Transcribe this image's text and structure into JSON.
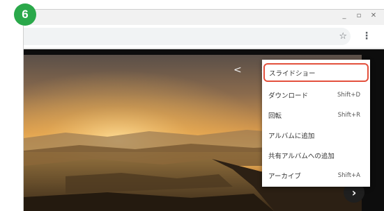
{
  "step_number": "6",
  "window": {
    "controls": [
      "_",
      "▫",
      "✕"
    ]
  },
  "toolbar": {
    "star_icon": "☆",
    "menu_icon": "⋮"
  },
  "viewer": {
    "share_icon": "<",
    "more_icon": "⋮",
    "next_icon": "›"
  },
  "menu": {
    "items": [
      {
        "label": "スライドショー",
        "shortcut": "",
        "highlighted": true
      },
      {
        "label": "ダウンロード",
        "shortcut": "Shift+D"
      },
      {
        "label": "回転",
        "shortcut": "Shift+R"
      },
      {
        "label": "アルバムに追加",
        "shortcut": ""
      },
      {
        "label": "共有アルバムへの追加",
        "shortcut": ""
      },
      {
        "label": "アーカイブ",
        "shortcut": "Shift+A"
      }
    ]
  },
  "colors": {
    "badge": "#2aa84a",
    "highlight_border": "#e3503c"
  }
}
